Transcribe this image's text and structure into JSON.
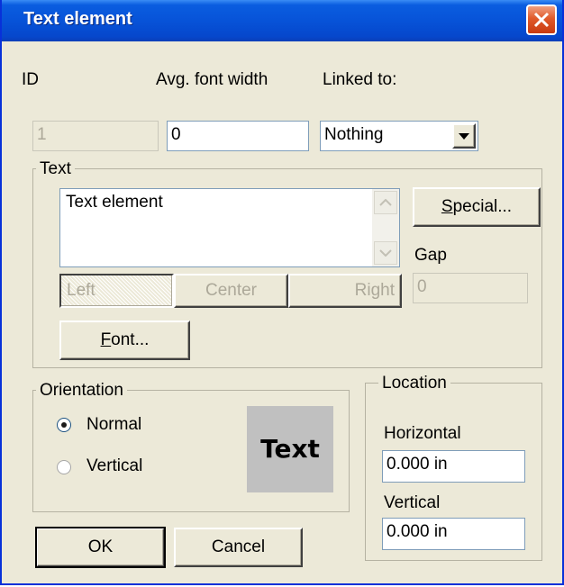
{
  "window": {
    "title": "Text element"
  },
  "header_labels": {
    "id": "ID",
    "avg_font_width": "Avg. font width",
    "linked_to": "Linked to:"
  },
  "fields": {
    "id_value": "1",
    "avg_font_width_value": "0",
    "linked_to_value": "Nothing"
  },
  "text_group": {
    "title": "Text",
    "content": "Text element",
    "special_prefix": "S",
    "special_rest": "pecial...",
    "gap_label": "Gap",
    "gap_value": "0",
    "align_left": "Left",
    "align_center": "Center",
    "align_right": "Right",
    "font_prefix": "F",
    "font_rest": "ont..."
  },
  "orientation_group": {
    "title": "Orientation",
    "normal_label": "Normal",
    "vertical_label": "Vertical",
    "selected": "Normal",
    "preview_text": "Text"
  },
  "location_group": {
    "title": "Location",
    "horizontal_label": "Horizontal",
    "horizontal_value": "0.000 in",
    "vertical_label": "Vertical",
    "vertical_value": "0.000 in"
  },
  "buttons": {
    "ok": "OK",
    "cancel": "Cancel"
  },
  "colors": {
    "title_bar": "#0753d8",
    "dialog_bg": "#ece9d8",
    "close_button": "#e05a2a",
    "preview_bg": "#c0c0c0"
  }
}
